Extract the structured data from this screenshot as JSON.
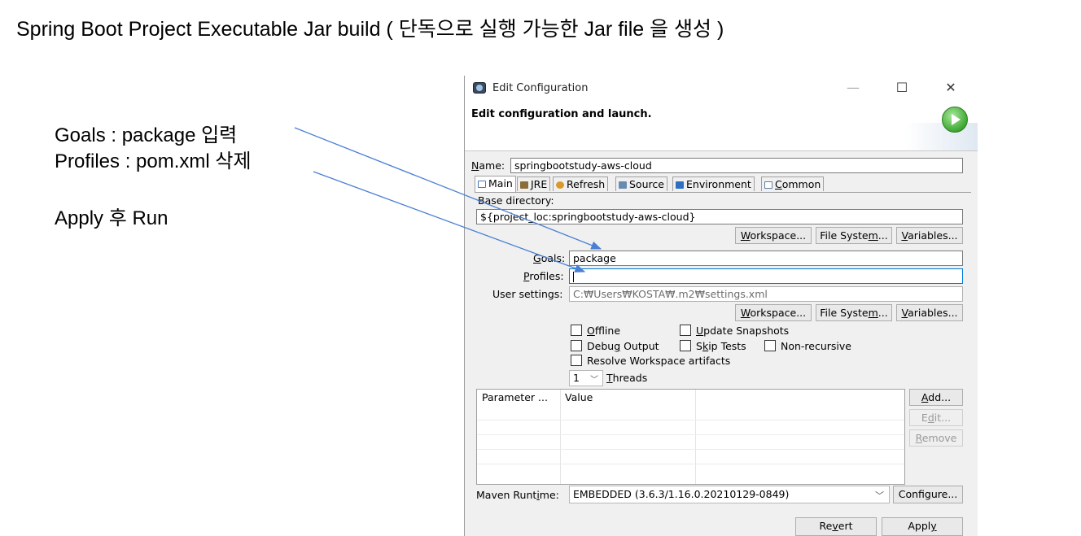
{
  "slide": {
    "title": "Spring Boot Project  Executable Jar build ( 단독으로 실행 가능한 Jar file 을 생성 )",
    "notes": [
      "Goals : package  입력",
      "Profiles : pom.xml 삭제",
      "Apply 후 Run"
    ]
  },
  "window": {
    "title": "Edit Configuration",
    "minimize": "—",
    "maximize": "☐",
    "close": "✕",
    "header": "Edit configuration and launch.",
    "run_icon": "run-play-icon"
  },
  "name": {
    "label": "Name:",
    "value": "springbootstudy-aws-cloud"
  },
  "tabs": [
    {
      "label": "Main",
      "icon": "main-tab-icon",
      "color": "#4a78b8"
    },
    {
      "label": "JRE",
      "icon": "jre-icon",
      "color": "#8a6d3b"
    },
    {
      "label": "Refresh",
      "icon": "refresh-icon",
      "color": "#d99a2b"
    },
    {
      "label": "Source",
      "icon": "source-icon",
      "color": "#6a8bb0"
    },
    {
      "label": "Environment",
      "icon": "environment-icon",
      "color": "#2f6fbf"
    },
    {
      "label": "Common",
      "icon": "common-icon",
      "color": "#5a7fa8"
    }
  ],
  "base_directory": {
    "label": "Base directory:",
    "value": "${project_loc:springbootstudy-aws-cloud}",
    "workspace": "Workspace...",
    "file_system": "File System...",
    "variables": "Variables..."
  },
  "goals": {
    "label": "Goals:",
    "value": "package"
  },
  "profiles": {
    "label": "Profiles:",
    "value": ""
  },
  "user_settings": {
    "label": "User settings:",
    "value": "C:₩Users₩KOSTA₩.m2₩settings.xml",
    "workspace": "Workspace...",
    "file_system": "File System...",
    "variables": "Variables..."
  },
  "options": {
    "offline": "Offline",
    "update_snapshots": "Update Snapshots",
    "debug_output": "Debug Output",
    "skip_tests": "Skip Tests",
    "non_recursive": "Non-recursive",
    "resolve_workspace": "Resolve Workspace artifacts",
    "threads_value": "1",
    "threads_label": "Threads"
  },
  "params_table": {
    "headers": [
      "Parameter ...",
      "Value"
    ],
    "rows": []
  },
  "side_buttons": {
    "add": "Add...",
    "edit": "Edit...",
    "remove": "Remove"
  },
  "runtime": {
    "label": "Maven Runtime:",
    "value": "EMBEDDED (3.6.3/1.16.0.20210129-0849)",
    "configure": "Configure..."
  },
  "bottom": {
    "revert": "Revert",
    "apply": "Apply"
  },
  "colors": {
    "arrow": "#4a7fd4",
    "focus": "#0078d7"
  }
}
